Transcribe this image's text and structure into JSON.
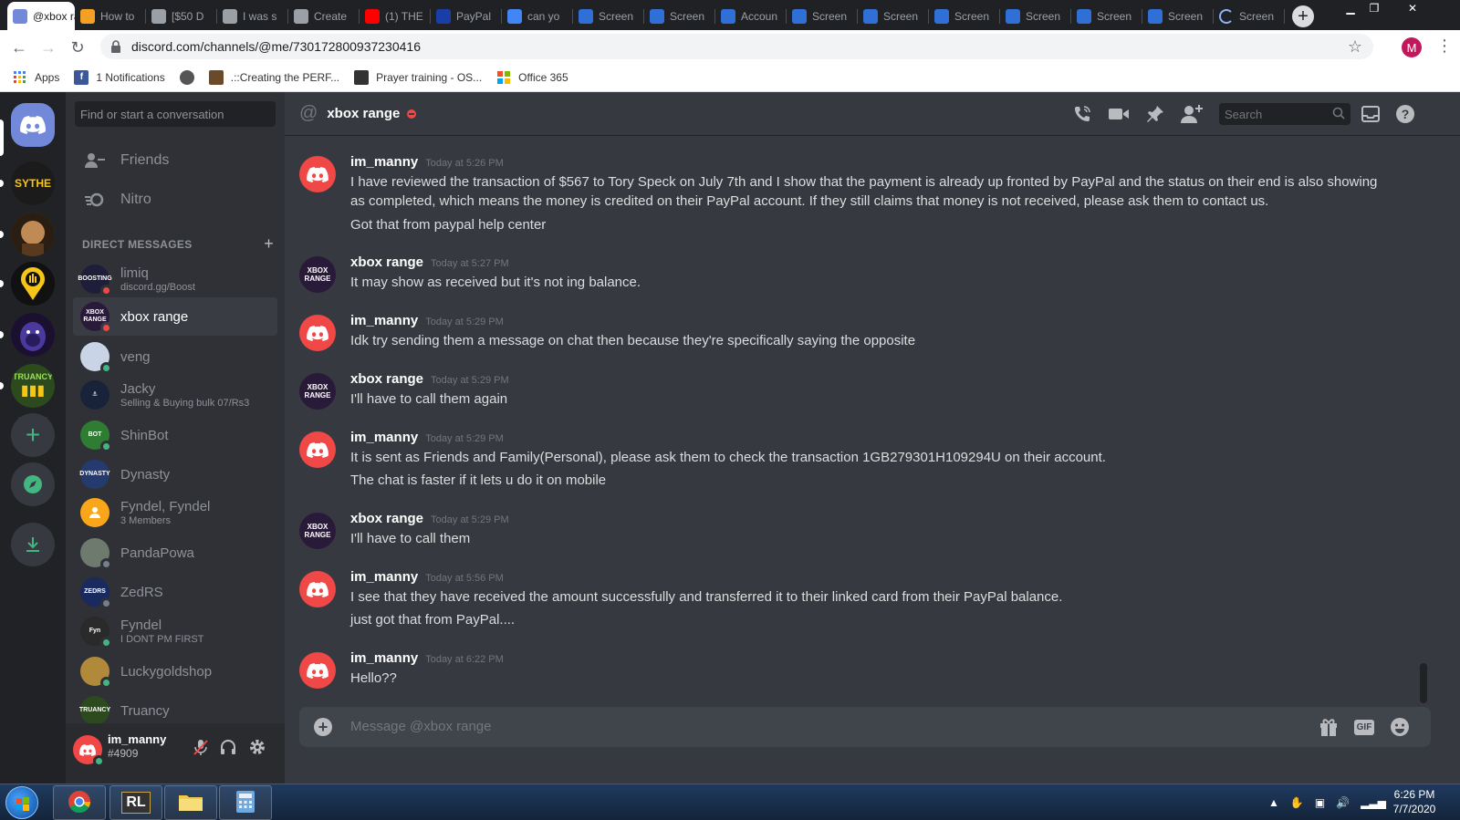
{
  "browser": {
    "tabs": [
      {
        "title": "@xbox range",
        "favicon": "discord-icon",
        "color": "#7289da",
        "active": true
      },
      {
        "title": "How to",
        "favicon": "pencil-icon",
        "color": "#f4a024"
      },
      {
        "title": "[$50 D",
        "favicon": "shield-icon",
        "color": "#9aa0a6"
      },
      {
        "title": "I was s",
        "favicon": "shield-icon",
        "color": "#9aa0a6"
      },
      {
        "title": "Create",
        "favicon": "shield-icon",
        "color": "#9aa0a6"
      },
      {
        "title": "(1) THE",
        "favicon": "youtube-icon",
        "color": "#ff0000"
      },
      {
        "title": "PayPal",
        "favicon": "paypal-icon",
        "color": "#1a3ea7"
      },
      {
        "title": "can yo",
        "favicon": "google-icon",
        "color": "#4285f4"
      },
      {
        "title": "Screen",
        "favicon": "screenshot-icon",
        "color": "#2f6fd6"
      },
      {
        "title": "Screen",
        "favicon": "screenshot-icon",
        "color": "#2f6fd6"
      },
      {
        "title": "Accoun",
        "favicon": "account-icon",
        "color": "#2f6fd6"
      },
      {
        "title": "Screen",
        "favicon": "screenshot-icon",
        "color": "#2f6fd6"
      },
      {
        "title": "Screen",
        "favicon": "screenshot-icon",
        "color": "#2f6fd6"
      },
      {
        "title": "Screen",
        "favicon": "screenshot-icon",
        "color": "#2f6fd6"
      },
      {
        "title": "Screen",
        "favicon": "screenshot-icon",
        "color": "#2f6fd6"
      },
      {
        "title": "Screen",
        "favicon": "screenshot-icon",
        "color": "#2f6fd6"
      },
      {
        "title": "Screen",
        "favicon": "screenshot-icon",
        "color": "#2f6fd6"
      },
      {
        "title": "Screen",
        "favicon": "loading-icon",
        "color": "#8ab4f8"
      }
    ],
    "url": "discord.com/channels/@me/730172800937230416",
    "profile_initial": "M",
    "bookmarks": [
      {
        "label": "Apps",
        "icon": "apps-grid-icon",
        "color": "#4285f4"
      },
      {
        "label": "1 Notifications",
        "icon": "facebook-icon",
        "color": "#3b5998"
      },
      {
        "label": "",
        "icon": "globe-icon",
        "color": "#555555"
      },
      {
        "label": ".::Creating the PERF...",
        "icon": "forum-icon",
        "color": "#6b4a2a"
      },
      {
        "label": "Prayer training - OS...",
        "icon": "os-icon",
        "color": "#333333"
      },
      {
        "label": "Office 365",
        "icon": "office-icon",
        "color": "#e74c0c"
      }
    ]
  },
  "discord": {
    "guilds": [
      {
        "name": "Home",
        "icon": "discord-home-icon",
        "color": "#7289da"
      },
      {
        "name": "SYTHE",
        "icon": "sythe-server-icon",
        "color": "#1b1b1b"
      },
      {
        "name": "",
        "icon": "face-server-icon",
        "color": "#7a5a2e"
      },
      {
        "name": "",
        "icon": "pin-server-icon",
        "color": "#111111"
      },
      {
        "name": "",
        "icon": "gorilla-server-icon",
        "color": "#3a2a6e"
      },
      {
        "name": "TRUANCY",
        "icon": "truancy-server-icon",
        "color": "#2c4a1e"
      }
    ],
    "search_placeholder": "Find or start a conversation",
    "nav": [
      {
        "label": "Friends",
        "icon": "friends-icon"
      },
      {
        "label": "Nitro",
        "icon": "nitro-icon"
      }
    ],
    "dm_header": "DIRECT MESSAGES",
    "dms": [
      {
        "name": "limiq",
        "sub": "discord.gg/Boost",
        "avatar": "BOOSTING",
        "color": "#1e1e3a",
        "status": "#f04747"
      },
      {
        "name": "xbox range",
        "sub": "",
        "avatar": "XBOX RANGE",
        "color": "#2a1a3a",
        "status": "#f04747",
        "selected": true
      },
      {
        "name": "veng",
        "sub": "",
        "avatar": "",
        "color": "#c9d4e6",
        "status": "#43b581"
      },
      {
        "name": "Jacky",
        "sub": "Selling & Buying bulk 07/Rs3",
        "avatar": "⚓",
        "color": "#18233a",
        "status": ""
      },
      {
        "name": "ShinBot",
        "sub": "",
        "avatar": "BOT",
        "color": "#2e7d32",
        "status": "#43b581"
      },
      {
        "name": "Dynasty",
        "sub": "",
        "avatar": "DYNASTY",
        "color": "#253a6e",
        "status": ""
      },
      {
        "name": "Fyndel, Fyndel",
        "sub": "3 Members",
        "avatar": "",
        "color": "#faa61a",
        "status": ""
      },
      {
        "name": "PandaPowa",
        "sub": "",
        "avatar": "",
        "color": "#6e7a6e",
        "status": "#747f8d"
      },
      {
        "name": "ZedRS",
        "sub": "",
        "avatar": "ZEDRS",
        "color": "#1a2a5e",
        "status": "#747f8d"
      },
      {
        "name": "Fyndel",
        "sub": "I DONT PM FIRST",
        "avatar": "Fyn",
        "color": "#2a2a2a",
        "status": "#43b581"
      },
      {
        "name": "Luckygoldshop",
        "sub": "",
        "avatar": "",
        "color": "#b08a3a",
        "status": "#43b581"
      },
      {
        "name": "Truancy",
        "sub": "",
        "avatar": "TRUANCY",
        "color": "#2c4a1e",
        "status": ""
      }
    ],
    "user": {
      "name": "im_manny",
      "tag": "#4909"
    },
    "channel": {
      "name": "xbox range",
      "search_placeholder": "Search"
    },
    "messages": [
      {
        "author": "im_manny",
        "time": "Today at 5:26 PM",
        "avatar": "discord",
        "lines": [
          "I have reviewed the transaction of $567 to Tory Speck on July 7th and I show that the payment is already up fronted by PayPal and the status on their end is also showing as completed, which means the money is credited on their PayPal account. If they still claims that money is not received, please ask them to contact us.",
          "Got that from paypal help center"
        ]
      },
      {
        "author": "xbox range",
        "time": "Today at 5:27 PM",
        "avatar": "xbox",
        "lines": [
          "It may show as received but it's not ing balance."
        ]
      },
      {
        "author": "im_manny",
        "time": "Today at 5:29 PM",
        "avatar": "discord",
        "lines": [
          "Idk try sending them a message on chat then because they're specifically saying the opposite"
        ]
      },
      {
        "author": "xbox range",
        "time": "Today at 5:29 PM",
        "avatar": "xbox",
        "lines": [
          "I'll have to call them again"
        ]
      },
      {
        "author": "im_manny",
        "time": "Today at 5:29 PM",
        "avatar": "discord",
        "lines": [
          "It is sent as Friends and Family(Personal), please ask them to check the transaction 1GB279301H109294U on their account.",
          "The chat is faster if it lets u do it on mobile"
        ]
      },
      {
        "author": "xbox range",
        "time": "Today at 5:29 PM",
        "avatar": "xbox",
        "lines": [
          "I'll have to call them"
        ]
      },
      {
        "author": "im_manny",
        "time": "Today at 5:56 PM",
        "avatar": "discord",
        "lines": [
          "I see that they have received the amount successfully and transferred it to their linked card from their PayPal balance.",
          "just got that from PayPal...."
        ]
      },
      {
        "author": "im_manny",
        "time": "Today at 6:22 PM",
        "avatar": "discord",
        "lines": [
          "Hello??"
        ]
      }
    ],
    "composer_placeholder": "Message @xbox range",
    "gif_label": "GIF"
  },
  "taskbar": {
    "apps": [
      {
        "name": "chrome-icon",
        "color": "#34a853"
      },
      {
        "name": "runelite-icon",
        "color": "#333333",
        "label": "RL"
      },
      {
        "name": "explorer-icon",
        "color": "#f2c94c"
      },
      {
        "name": "calculator-icon",
        "color": "#6fa8dc"
      }
    ],
    "time": "6:26 PM",
    "date": "7/7/2020"
  },
  "colors": {
    "discord_blurple": "#7289da",
    "discord_red": "#f04747",
    "online": "#43b581",
    "idle_offline": "#747f8d"
  }
}
